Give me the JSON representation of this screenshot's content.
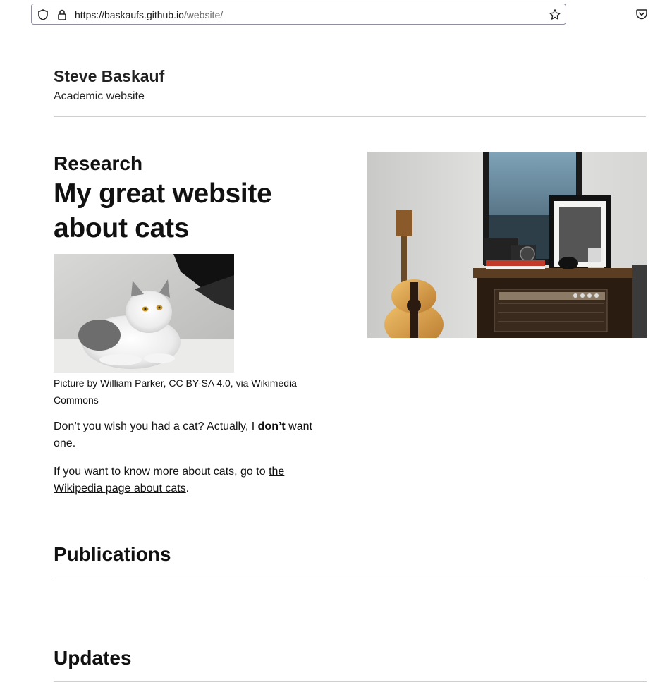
{
  "browser": {
    "url_host": "https://baskaufs.github.io",
    "url_path": "/website/"
  },
  "site": {
    "title": "Steve Baskauf",
    "subtitle": "Academic website"
  },
  "research": {
    "section_heading": "Research",
    "page_heading": "My great website about cats",
    "caption": "Picture by William Parker, CC BY-SA 4.0, via Wikimedia Commons",
    "para1_before": "Don’t you wish you had a cat? Actually, I ",
    "para1_bold": "don’t",
    "para1_after": " want one.",
    "para2_before": "If you want to know more about cats, go to ",
    "para2_link": "the Wikipedia page about cats",
    "para2_after": "."
  },
  "publications": {
    "heading": "Publications"
  },
  "updates": {
    "heading": "Updates"
  },
  "icons": {
    "shield": "shield-icon",
    "lock": "lock-icon",
    "star": "bookmark-star-icon",
    "pocket": "pocket-icon"
  }
}
